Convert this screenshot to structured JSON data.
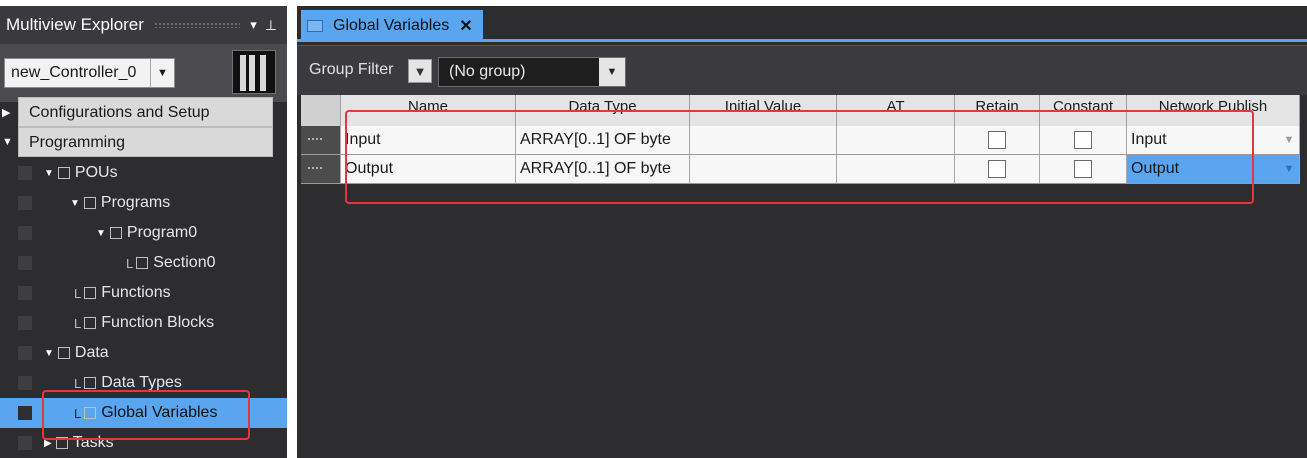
{
  "explorer": {
    "title": "Multiview Explorer",
    "dropdown_glyph": "▾",
    "pin_glyph": "⊥",
    "controller": {
      "selected": "new_Controller_0",
      "arrow": "▼"
    },
    "sections": [
      {
        "label": "Configurations and Setup",
        "expanded": false,
        "toggle": "▶"
      },
      {
        "label": "Programming",
        "expanded": true,
        "toggle": "▼"
      }
    ],
    "tree": [
      {
        "label": "POUs",
        "toggle": "▼",
        "icon": "pou-icon"
      },
      {
        "label": "Programs",
        "toggle": "▼",
        "icon": "programs-icon"
      },
      {
        "label": "Program0",
        "toggle": "▼",
        "icon": "program-icon"
      },
      {
        "label": "Section0",
        "prefix": "L",
        "icon": "section-icon"
      },
      {
        "label": "Functions",
        "prefix": "L",
        "icon": "functions-icon"
      },
      {
        "label": "Function Blocks",
        "prefix": "L",
        "icon": "function-blocks-icon"
      },
      {
        "label": "Data",
        "toggle": "▼",
        "icon": "data-icon"
      },
      {
        "label": "Data Types",
        "prefix": "L",
        "icon": "data-types-icon"
      },
      {
        "label": "Global Variables",
        "prefix": "L",
        "icon": "global-variables-icon",
        "selected": true
      },
      {
        "label": "Tasks",
        "toggle": "▶",
        "icon": "tasks-icon"
      }
    ]
  },
  "editor": {
    "tab": {
      "label": "Global Variables",
      "close": "✕"
    },
    "filter": {
      "label": "Group Filter",
      "filter_icon": "▼",
      "value": "(No group)",
      "arrow": "▼"
    },
    "columns": [
      "Name",
      "Data Type",
      "Initial Value",
      "AT",
      "Retain",
      "Constant",
      "Network Publish"
    ],
    "rows": [
      {
        "name": "Input",
        "data_type": "ARRAY[0..1] OF byte",
        "initial_value": "",
        "at": "",
        "retain": false,
        "constant": false,
        "network_publish": "Input",
        "selected_publish": false
      },
      {
        "name": "Output",
        "data_type": "ARRAY[0..1] OF byte",
        "initial_value": "",
        "at": "",
        "retain": false,
        "constant": false,
        "network_publish": "Output",
        "selected_publish": true
      }
    ],
    "dropdown_arrow": "▼"
  },
  "colors": {
    "accent_blue": "#59a5f0",
    "highlight_red": "#e1393a",
    "panel_dark": "#2d2d30"
  }
}
